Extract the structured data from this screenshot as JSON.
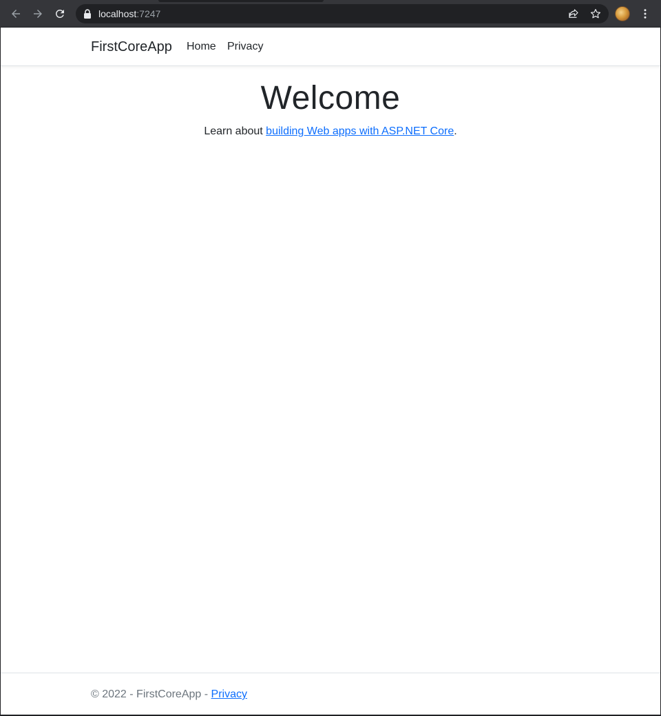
{
  "browser": {
    "url_host": "localhost",
    "url_port": ":7247",
    "icons": [
      "back-icon",
      "forward-icon",
      "reload-icon",
      "lock-icon",
      "share-icon",
      "bookmark-star-icon",
      "profile-avatar",
      "menu-kebab-icon"
    ]
  },
  "navbar": {
    "brand": "FirstCoreApp",
    "links": [
      "Home",
      "Privacy"
    ]
  },
  "main": {
    "heading": "Welcome",
    "learn_prefix": "Learn about ",
    "learn_link": "building Web apps with ASP.NET Core",
    "learn_suffix": "."
  },
  "footer": {
    "copyright": "© 2022 - FirstCoreApp - ",
    "privacy_link": "Privacy"
  },
  "colors": {
    "link": "#0d6efd",
    "text": "#212529",
    "muted": "#6c757d",
    "chrome_bg": "#35363a",
    "omnibox_bg": "#202124"
  }
}
